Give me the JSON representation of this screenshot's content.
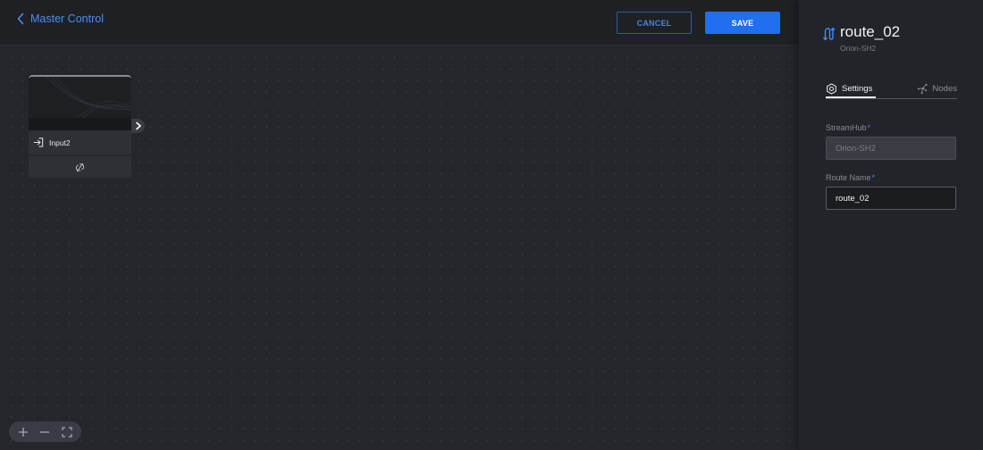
{
  "header": {
    "back_label": "Master Control",
    "cancel_label": "CANCEL",
    "save_label": "SAVE"
  },
  "canvas": {
    "nodes": [
      {
        "label": "Input2",
        "type": "input",
        "status_icon": "no-link-icon"
      }
    ],
    "zoom_controls": {
      "zoom_in": "plus-icon",
      "zoom_out": "minus-icon",
      "fit": "fullscreen-icon"
    }
  },
  "panel": {
    "title": "route_02",
    "subtitle": "Orion-SH2",
    "tabs": [
      {
        "label": "Settings",
        "icon": "gear-icon",
        "active": true
      },
      {
        "label": "Nodes",
        "icon": "nodes-icon",
        "active": false
      }
    ],
    "fields": {
      "streamhub": {
        "label": "StreamHub",
        "required_mark": "*",
        "value": "Orion-SH2",
        "disabled": true
      },
      "route_name": {
        "label": "Route Name",
        "required_mark": "*",
        "value": "route_02",
        "disabled": false
      }
    }
  },
  "colors": {
    "accent": "#1f6ff0",
    "link": "#4b8ef0",
    "background": "#25262b",
    "panel": "#232429"
  }
}
